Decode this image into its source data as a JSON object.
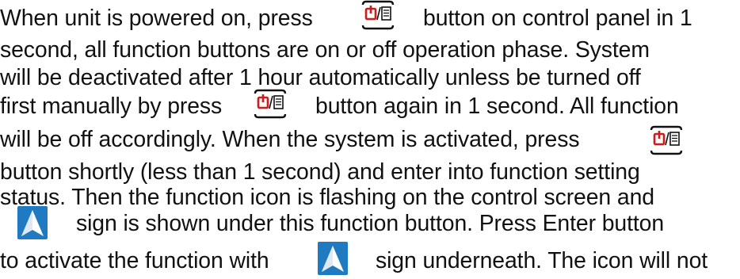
{
  "icons": {
    "power_menu_button": "power-menu-icon",
    "arrow_sign": "navigation-arrow-icon"
  },
  "colors": {
    "power_icon": "#d11a1a",
    "arrow_bg": "#1f7ac2"
  },
  "lines": [
    {
      "before": "When unit is powered on, press",
      "after": "button on control panel in 1"
    },
    {
      "text": "second, all function buttons are on or off operation phase. System"
    },
    {
      "text": "will be deactivated after 1 hour automatically unless be turned off"
    },
    {
      "before": "first manually by press",
      "after": "button again in 1 second. All function"
    },
    {
      "before": "will be off accordingly. When the system is activated, press",
      "after": ""
    },
    {
      "text": "button shortly (less than 1 second) and enter into function setting"
    },
    {
      "text": "status. Then the function icon is flashing on the control screen and"
    },
    {
      "before": "",
      "after": "sign is shown under this function button. Press Enter button"
    },
    {
      "before": "to activate the function with",
      "after": "sign underneath. The icon will not"
    }
  ]
}
